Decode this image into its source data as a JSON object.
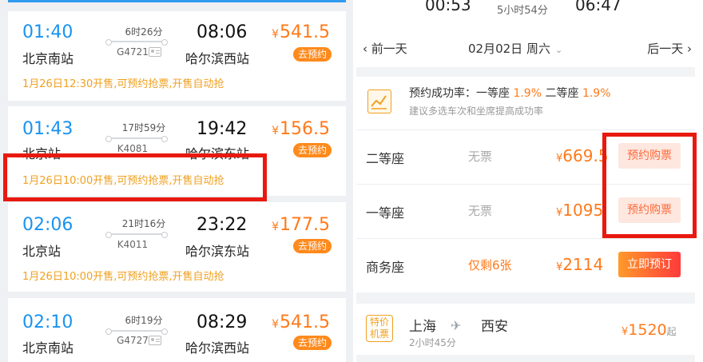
{
  "colors": {
    "accent_blue": "#1a93ef",
    "price_orange": "#ff7a1a",
    "highlight_red": "#e8190f",
    "note_amber": "#f0a020"
  },
  "trains": [
    {
      "dep_time": "01:40",
      "dep_station": "北京南站",
      "duration": "6时26分",
      "train_no": "G4721",
      "arr_time": "08:06",
      "arr_station": "哈尔滨西站",
      "price": "541.5",
      "button": "去预约",
      "note": "1月26日12:30开售,可预约抢票,开售自动抢"
    },
    {
      "dep_time": "01:43",
      "dep_station": "北京站",
      "duration": "17时59分",
      "train_no": "K4081",
      "arr_time": "19:42",
      "arr_station": "哈尔滨东站",
      "price": "156.5",
      "button": "去预约",
      "note": "1月26日10:00开售,可预约抢票,开售自动抢"
    },
    {
      "dep_time": "02:06",
      "dep_station": "北京站",
      "duration": "21时16分",
      "train_no": "K4011",
      "arr_time": "23:22",
      "arr_station": "哈尔滨东站",
      "price": "177.5",
      "button": "去预约",
      "note": "1月26日10:00开售,可预约抢票,开售自动抢"
    },
    {
      "dep_time": "02:10",
      "dep_station": "北京南站",
      "duration": "6时19分",
      "train_no": "G4727",
      "arr_time": "08:29",
      "arr_station": "哈尔滨西站",
      "price": "541.5",
      "button": "去预约"
    }
  ],
  "currency": "¥",
  "detail": {
    "top": {
      "dep_time": "00:53",
      "duration": "5小时54分",
      "arr_time": "06:47"
    },
    "date_nav": {
      "prev": "前一天",
      "date": "02月02日 周六",
      "next": "后一天"
    },
    "rate": {
      "label": "预约成功率：一等座",
      "first_pct": "1.9%",
      "second_label": "二等座",
      "second_pct": "1.9%",
      "tip": "建议多选车次和坐席提高成功率"
    },
    "seats": [
      {
        "name": "二等座",
        "avail": "无票",
        "price": "669.5",
        "button": "预约购票"
      },
      {
        "name": "一等座",
        "avail": "无票",
        "price": "1095",
        "button": "预约购票"
      },
      {
        "name": "商务座",
        "avail": "仅剩6张",
        "price": "2114",
        "button": "立即预订"
      }
    ],
    "flight": {
      "tag_line1": "特价",
      "tag_line2": "机票",
      "from": "上海",
      "to": "西安",
      "duration": "2小时45分",
      "price": "1520",
      "suffix": "起"
    }
  }
}
